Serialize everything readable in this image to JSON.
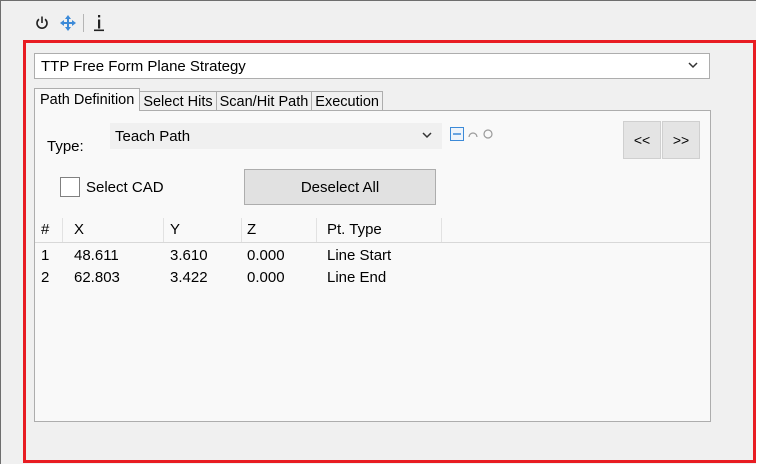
{
  "toolbar": {
    "items": [
      {
        "name": "power-icon",
        "glyph": "⏻"
      },
      {
        "name": "move-icon",
        "glyph": "✥"
      },
      {
        "name": "info-icon",
        "glyph": "i"
      }
    ]
  },
  "strategy": {
    "selected": "TTP Free Form Plane Strategy"
  },
  "tabs": [
    {
      "label": "Path Definition",
      "active": true
    },
    {
      "label": "Select Hits",
      "active": false
    },
    {
      "label": "Scan/Hit Path",
      "active": false
    },
    {
      "label": "Execution",
      "active": false
    }
  ],
  "path_definition": {
    "type_label": "Type:",
    "type_value": "Teach Path",
    "prev_label": "<<",
    "next_label": ">>",
    "select_cad_label": "Select CAD",
    "select_cad_checked": false,
    "deselect_label": "Deselect All"
  },
  "grid": {
    "headers": [
      "#",
      "X",
      "Y",
      "Z",
      "Pt. Type"
    ],
    "rows": [
      [
        "1",
        "48.611",
        "3.610",
        "0.000",
        "Line Start"
      ],
      [
        "2",
        "62.803",
        "3.422",
        "0.000",
        "Line End"
      ]
    ]
  },
  "colors": {
    "highlight_border": "#e81c22",
    "accent_icon": "#3c8ad8"
  }
}
